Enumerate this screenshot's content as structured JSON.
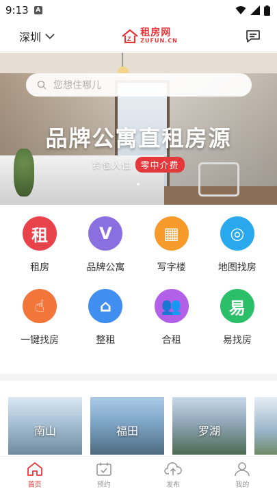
{
  "status_bar": {
    "time": "9:13",
    "notification_icon": "A"
  },
  "header": {
    "city": "深圳",
    "logo_cn": "租房网",
    "logo_en": "ZUFUN.CN",
    "message_icon": "message-icon"
  },
  "banner": {
    "search_placeholder": "您想住哪儿",
    "title": "品牌公寓直租房源",
    "subtitle": "拎包入住",
    "badge": "零中介费"
  },
  "categories": [
    {
      "label": "租房",
      "glyph": "租",
      "color": "#e8434b"
    },
    {
      "label": "品牌公寓",
      "glyph": "V",
      "color": "#8a6fe0"
    },
    {
      "label": "写字楼",
      "glyph": "▦",
      "color": "#f59a2b"
    },
    {
      "label": "地图找房",
      "glyph": "◎",
      "color": "#2aa8ee"
    },
    {
      "label": "一键找房",
      "glyph": "☝",
      "color": "#f2763a"
    },
    {
      "label": "整租",
      "glyph": "⌂",
      "color": "#3f8ef0"
    },
    {
      "label": "合租",
      "glyph": "👥",
      "color": "#b260e8"
    },
    {
      "label": "易找房",
      "glyph": "易",
      "color": "#2bbf6a"
    }
  ],
  "districts": [
    "南山",
    "福田",
    "罗湖"
  ],
  "tabs": [
    {
      "label": "首页",
      "icon": "home-icon",
      "active": true
    },
    {
      "label": "预约",
      "icon": "calendar-icon",
      "active": false
    },
    {
      "label": "发布",
      "icon": "upload-icon",
      "active": false
    },
    {
      "label": "我的",
      "icon": "profile-icon",
      "active": false
    }
  ],
  "colors": {
    "brand": "#e4383c",
    "tab_inactive": "#999999"
  }
}
